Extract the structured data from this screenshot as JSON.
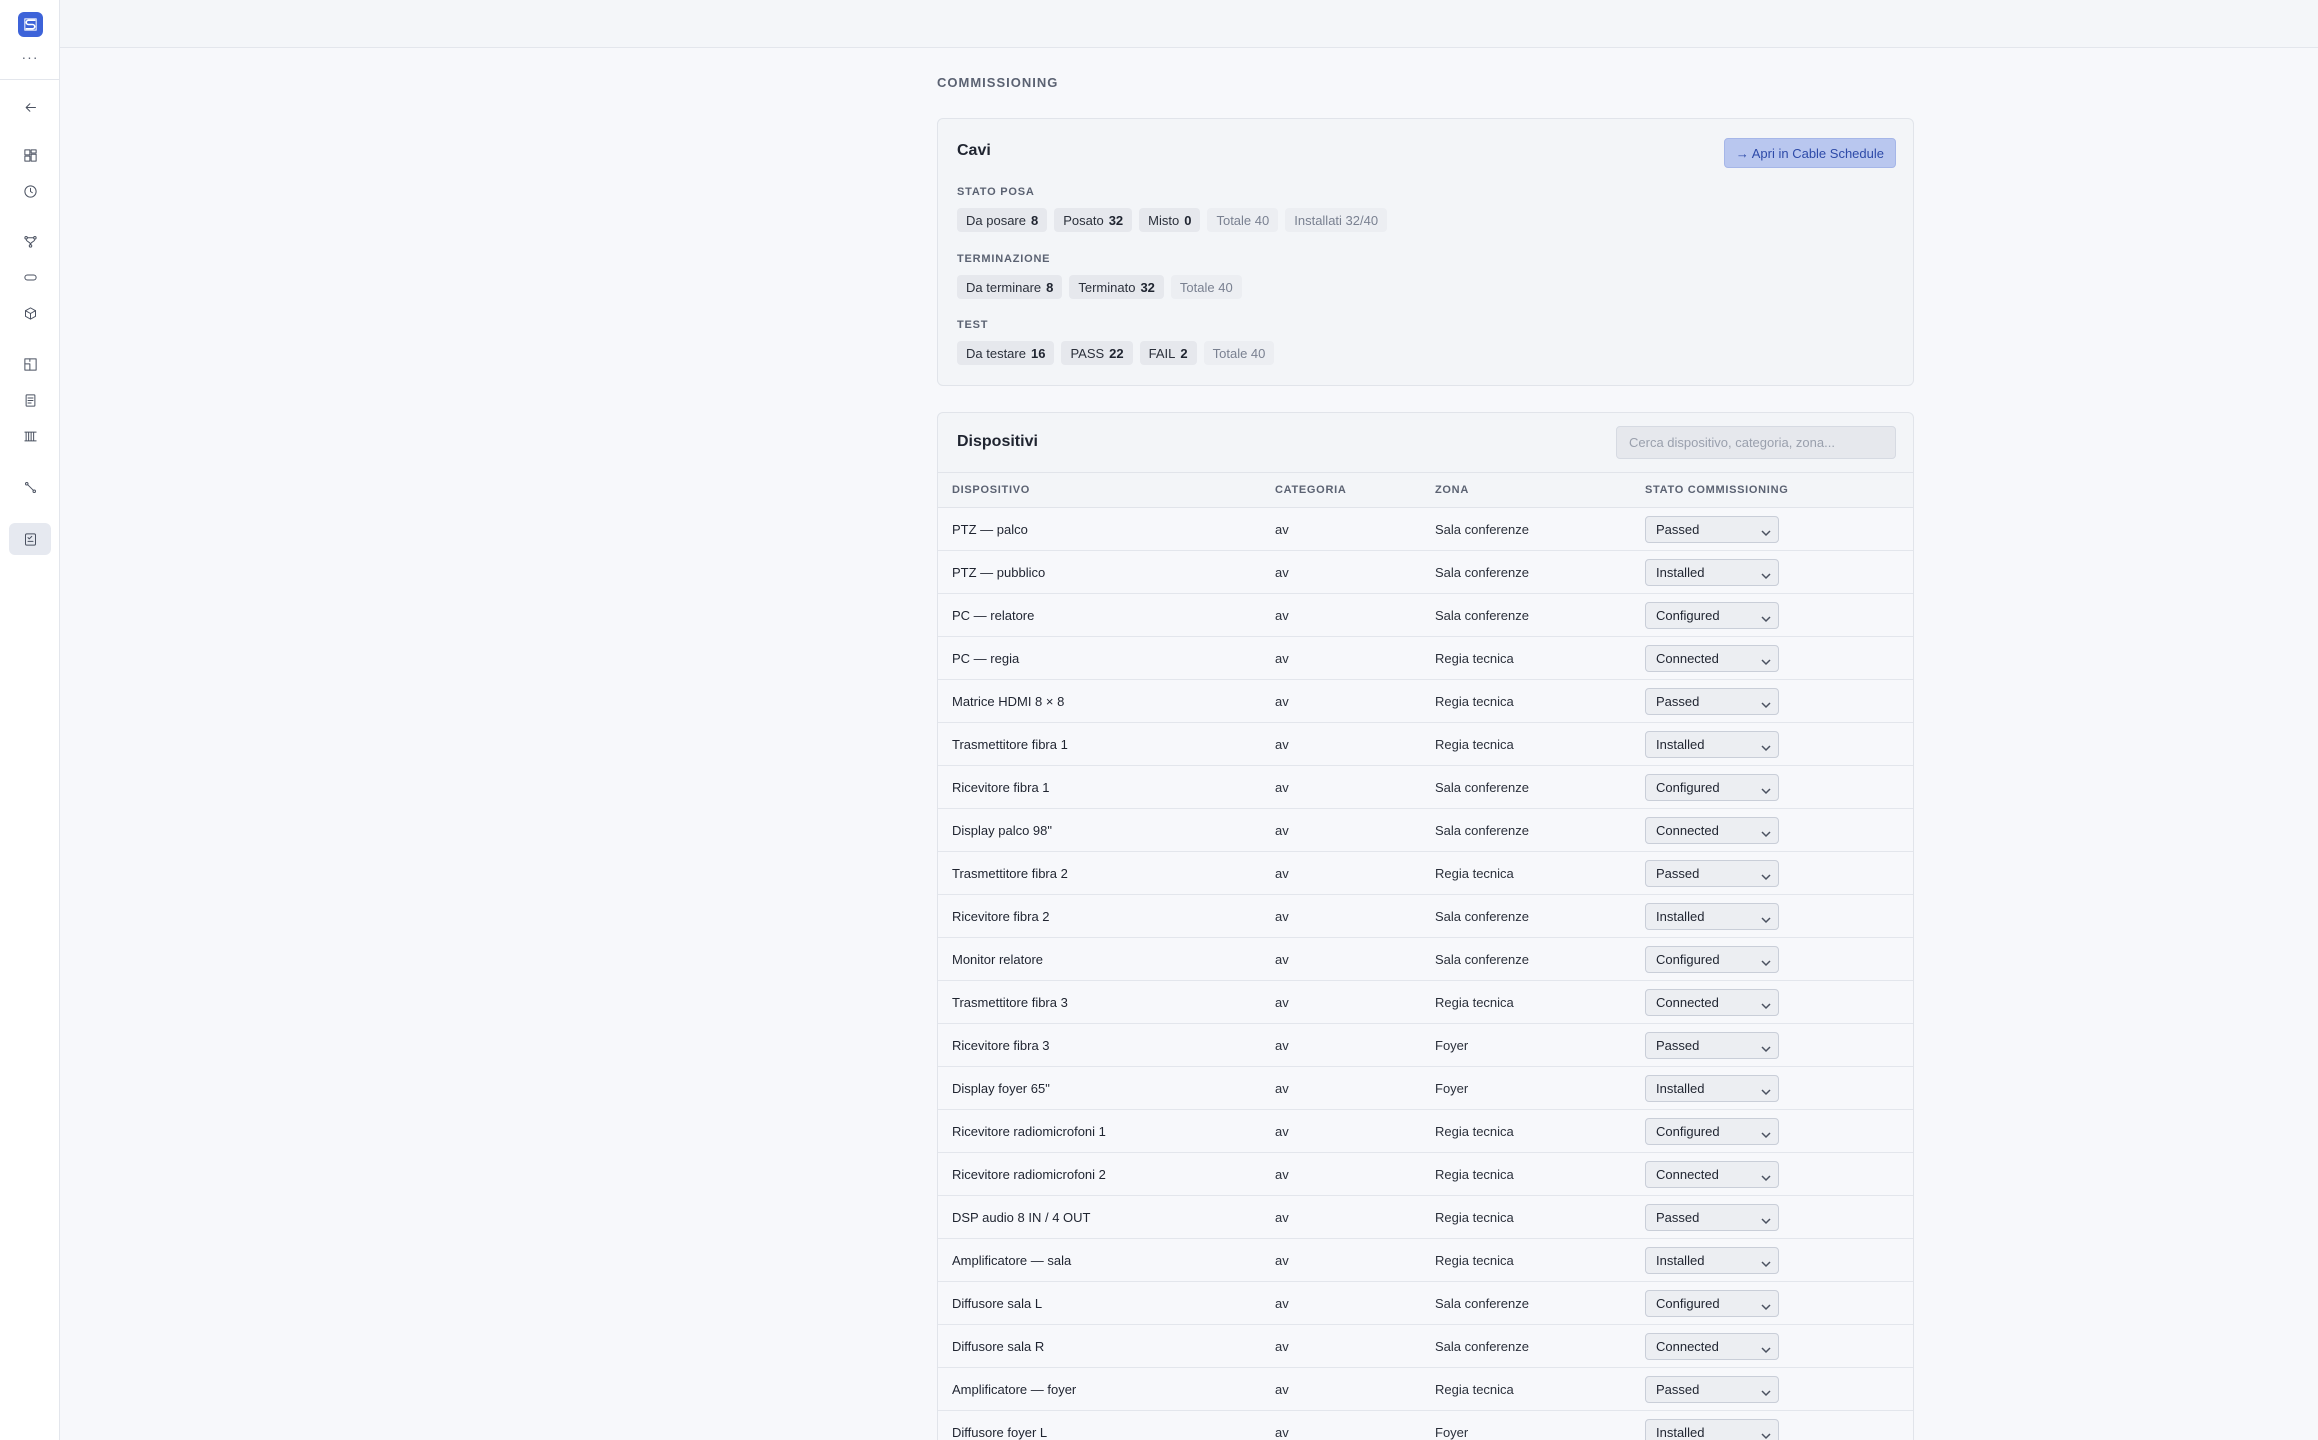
{
  "sidebar": {
    "more_label": "···",
    "icons": [
      {
        "name": "back-arrow-icon"
      },
      {
        "name": "dashboard-icon"
      },
      {
        "name": "history-icon"
      },
      {
        "name": "branches-icon"
      },
      {
        "name": "tag-icon"
      },
      {
        "name": "package-icon"
      },
      {
        "name": "floorplan-icon"
      },
      {
        "name": "document-icon"
      },
      {
        "name": "rack-icon"
      },
      {
        "name": "cable-icon"
      },
      {
        "name": "commissioning-icon"
      }
    ]
  },
  "section_label": "COMMISSIONING",
  "cables": {
    "title": "Cavi",
    "open_button": "→ Apri in Cable Schedule",
    "groups": [
      {
        "label": "STATO POSA",
        "chips": [
          {
            "text": "Da posare",
            "value": "8",
            "muted": false
          },
          {
            "text": "Posato",
            "value": "32",
            "muted": false
          },
          {
            "text": "Misto",
            "value": "0",
            "muted": false
          },
          {
            "text": "Totale 40",
            "value": "",
            "muted": true
          },
          {
            "text": "Installati 32/40",
            "value": "",
            "muted": true
          }
        ]
      },
      {
        "label": "TERMINAZIONE",
        "chips": [
          {
            "text": "Da terminare",
            "value": "8",
            "muted": false
          },
          {
            "text": "Terminato",
            "value": "32",
            "muted": false
          },
          {
            "text": "Totale 40",
            "value": "",
            "muted": true
          }
        ]
      },
      {
        "label": "TEST",
        "chips": [
          {
            "text": "Da testare",
            "value": "16",
            "muted": false
          },
          {
            "text": "PASS",
            "value": "22",
            "muted": false
          },
          {
            "text": "FAIL",
            "value": "2",
            "muted": false
          },
          {
            "text": "Totale 40",
            "value": "",
            "muted": true
          }
        ]
      }
    ]
  },
  "devices": {
    "title": "Dispositivi",
    "search_placeholder": "Cerca dispositivo, categoria, zona...",
    "columns": [
      "DISPOSITIVO",
      "CATEGORIA",
      "ZONA",
      "STATO COMMISSIONING"
    ],
    "status_options": [
      "Installed",
      "Connected",
      "Configured",
      "Passed"
    ],
    "rows": [
      {
        "device": "PTZ — palco",
        "category": "av",
        "zone": "Sala conferenze",
        "status": "Passed"
      },
      {
        "device": "PTZ — pubblico",
        "category": "av",
        "zone": "Sala conferenze",
        "status": "Installed"
      },
      {
        "device": "PC — relatore",
        "category": "av",
        "zone": "Sala conferenze",
        "status": "Configured"
      },
      {
        "device": "PC — regia",
        "category": "av",
        "zone": "Regia tecnica",
        "status": "Connected"
      },
      {
        "device": "Matrice HDMI 8 × 8",
        "category": "av",
        "zone": "Regia tecnica",
        "status": "Passed"
      },
      {
        "device": "Trasmettitore fibra 1",
        "category": "av",
        "zone": "Regia tecnica",
        "status": "Installed"
      },
      {
        "device": "Ricevitore fibra 1",
        "category": "av",
        "zone": "Sala conferenze",
        "status": "Configured"
      },
      {
        "device": "Display palco 98\"",
        "category": "av",
        "zone": "Sala conferenze",
        "status": "Connected"
      },
      {
        "device": "Trasmettitore fibra 2",
        "category": "av",
        "zone": "Regia tecnica",
        "status": "Passed"
      },
      {
        "device": "Ricevitore fibra 2",
        "category": "av",
        "zone": "Sala conferenze",
        "status": "Installed"
      },
      {
        "device": "Monitor relatore",
        "category": "av",
        "zone": "Sala conferenze",
        "status": "Configured"
      },
      {
        "device": "Trasmettitore fibra 3",
        "category": "av",
        "zone": "Regia tecnica",
        "status": "Connected"
      },
      {
        "device": "Ricevitore fibra 3",
        "category": "av",
        "zone": "Foyer",
        "status": "Passed"
      },
      {
        "device": "Display foyer 65\"",
        "category": "av",
        "zone": "Foyer",
        "status": "Installed"
      },
      {
        "device": "Ricevitore radiomicrofoni 1",
        "category": "av",
        "zone": "Regia tecnica",
        "status": "Configured"
      },
      {
        "device": "Ricevitore radiomicrofoni 2",
        "category": "av",
        "zone": "Regia tecnica",
        "status": "Connected"
      },
      {
        "device": "DSP audio 8 IN / 4 OUT",
        "category": "av",
        "zone": "Regia tecnica",
        "status": "Passed"
      },
      {
        "device": "Amplificatore — sala",
        "category": "av",
        "zone": "Regia tecnica",
        "status": "Installed"
      },
      {
        "device": "Diffusore sala L",
        "category": "av",
        "zone": "Sala conferenze",
        "status": "Configured"
      },
      {
        "device": "Diffusore sala R",
        "category": "av",
        "zone": "Sala conferenze",
        "status": "Connected"
      },
      {
        "device": "Amplificatore — foyer",
        "category": "av",
        "zone": "Regia tecnica",
        "status": "Passed"
      },
      {
        "device": "Diffusore foyer L",
        "category": "av",
        "zone": "Foyer",
        "status": "Installed"
      }
    ]
  }
}
